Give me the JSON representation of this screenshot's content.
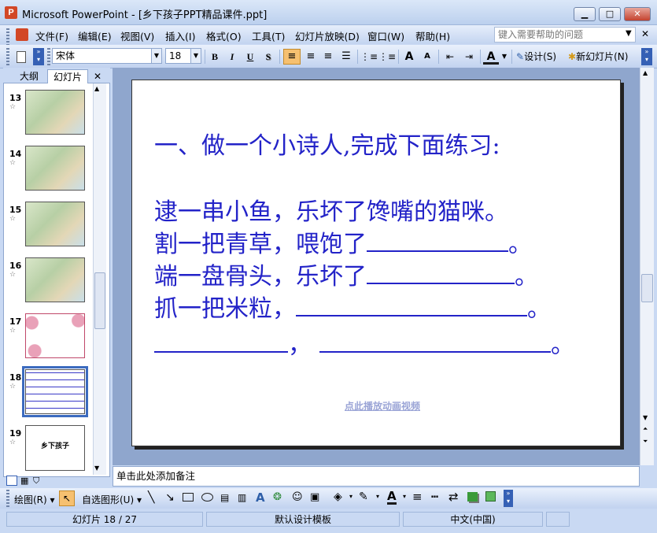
{
  "window": {
    "title": "Microsoft PowerPoint - [乡下孩子PPT精品课件.ppt]",
    "app_icon_letter": "P",
    "buttons": {
      "minimize": "▁",
      "maximize": "□",
      "close": "✕"
    }
  },
  "menu": {
    "items": [
      "文件(F)",
      "编辑(E)",
      "视图(V)",
      "插入(I)",
      "格式(O)",
      "工具(T)",
      "幻灯片放映(D)",
      "窗口(W)",
      "帮助(H)"
    ],
    "help_placeholder": "键入需要帮助的问题"
  },
  "toolbar": {
    "font_name": "宋体",
    "font_size": "18",
    "bold": "B",
    "italic": "I",
    "underline": "U",
    "shadow": "S",
    "increase_font": "A",
    "decrease_font": "A",
    "font_color": "A",
    "design_label": "设计(S)",
    "new_slide_label": "新幻灯片(N)"
  },
  "left_panel": {
    "tab_outline": "大纲",
    "tab_slides": "幻灯片",
    "close_glyph": "✕",
    "slides": [
      {
        "num": "13",
        "selected": false
      },
      {
        "num": "14",
        "selected": false
      },
      {
        "num": "15",
        "selected": false
      },
      {
        "num": "16",
        "selected": false
      },
      {
        "num": "17",
        "selected": false
      },
      {
        "num": "18",
        "selected": true
      },
      {
        "num": "19",
        "selected": false,
        "title": "乡下孩子"
      }
    ]
  },
  "slide": {
    "heading": "一、做一个小诗人,完成下面练习:",
    "lines": [
      "逮一串小鱼，乐坏了馋嘴的猫咪。",
      "割一把青草，喂饱了",
      "端一盘骨头，乐坏了",
      "抓一把米粒，"
    ],
    "comma": "，",
    "period": "。",
    "link_text": "点此播放动画视频"
  },
  "notes_placeholder": "单击此处添加备注",
  "drawbar": {
    "draw_label": "绘图(R)",
    "autoshape_label": "自选图形(U)"
  },
  "status": {
    "slide_pos": "幻灯片 18 / 27",
    "template": "默认设计模板",
    "language": "中文(中国)"
  },
  "colors": {
    "slide_text": "#2323c8",
    "frame": "#c9d9f3"
  }
}
